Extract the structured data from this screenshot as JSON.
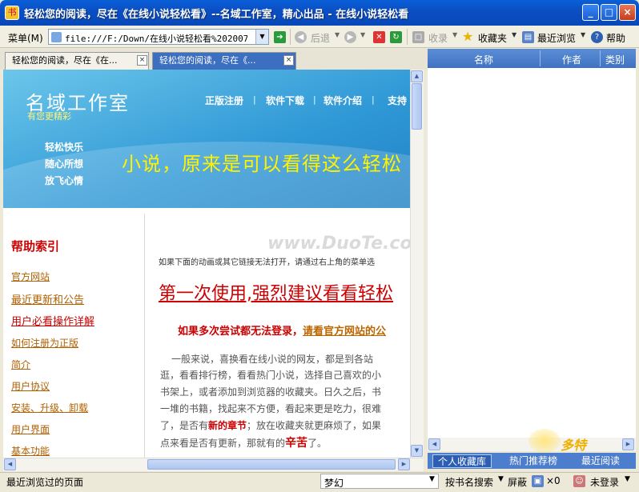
{
  "window": {
    "title": "轻松您的阅读，尽在《在线小说轻松看》--名域工作室，精心出品 - 在线小说轻松看",
    "minimize": "_",
    "maximize": "□",
    "close": "×"
  },
  "toolbar": {
    "menu": "菜单(M)",
    "address": "file:///F:/Down/在线小说轻松看%202007.2",
    "back": "后退",
    "collect": "收录",
    "favorites": "收藏夹",
    "recent": "最近浏览",
    "help": "帮助"
  },
  "tabs": [
    {
      "label": "轻松您的阅读，尽在《在...",
      "close": "×"
    },
    {
      "label": "轻松您的阅读，尽在《...",
      "close": "×"
    }
  ],
  "banner": {
    "brand": "名域工作室",
    "sub": "有您更精彩",
    "nav": [
      "正版注册",
      "软件下载",
      "软件介绍",
      "支持"
    ],
    "slogans": [
      "轻松快乐",
      "随心所想",
      "放飞心情"
    ],
    "headline": "小说，原来是可以看得这么轻松"
  },
  "help": {
    "title": "帮助索引",
    "links": [
      "官方网站",
      "最近更新和公告",
      "用户必看操作详解",
      "如何注册为正版",
      "简介",
      "用户协议",
      "安装、升级、卸载",
      "用户界面",
      "基本功能"
    ]
  },
  "main": {
    "notice": "如果下面的动画或其它链接无法打开，请通过右上角的菜单选",
    "big_link": "第一次使用,强烈建议看看轻松",
    "warn": "如果多次尝试都无法登录，",
    "warn_link": "请看官方网站的公",
    "para": [
      "一般来说，喜换看在线小说的网友，都是到各站",
      "逛，看看排行榜，看看热门小说，选择自己喜欢的小",
      "书架上，或者添加到浏览器的收藏夹。日久之后，书",
      "一堆的书籍，找起来不方便，看起来更是吃力，很难",
      "了，是否有",
      "新的章节",
      "；放在收藏夹就更麻烦了，如果",
      "点来看是否有更新，那就有的",
      "辛苦",
      "了。"
    ]
  },
  "watermark": "www.DuoTe.com",
  "sidebar": {
    "cols": [
      "名称",
      "作者",
      "类别"
    ],
    "tabs": [
      "个人收藏库",
      "热门推荐榜",
      "最近阅读"
    ]
  },
  "status": {
    "left": "最近浏览过的页面",
    "dream": "梦幻",
    "search": "按书名搜索",
    "block": "屏蔽",
    "count": "×0",
    "login": "未登录"
  },
  "colors": {
    "title": "#0a5fd8",
    "banner": "#2f98d6",
    "accent": "#cc0000"
  }
}
